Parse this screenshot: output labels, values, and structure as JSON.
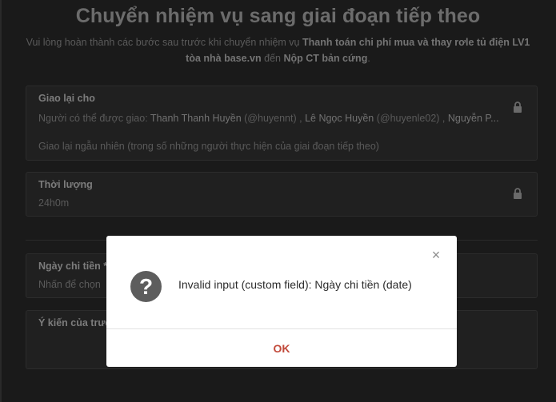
{
  "page": {
    "title": "Chuyển nhiệm vụ sang giai đoạn tiếp theo",
    "subtitle": {
      "prefix": "Vui lòng hoàn thành các bước sau trước khi chuyển nhiệm vụ ",
      "task": "Thanh toán chi phí mua và thay rơle tủ điện LV1 tòa nhà base.vn",
      "middle": " đến ",
      "stage": "Nộp CT bản cứng",
      "suffix": "."
    }
  },
  "reassign": {
    "label": "Giao lại cho",
    "assignees_prefix": "Người có thể được giao: ",
    "assignee1_name": "Thanh Thanh Huyền",
    "assignee1_handle": " (@huyennt)",
    "sep": "  , ",
    "assignee2_name": "Lê Ngọc Huyền",
    "assignee2_handle": " (@huyenle02)",
    "sep2": "  , ",
    "assignee3_name": "Nguyễn P...",
    "random_text": "Giao lại ngẫu nhiên (trong số những người thực hiện của giai đoạn tiếp theo)"
  },
  "duration": {
    "label": "Thời lượng",
    "value": "24h0m"
  },
  "payment_date": {
    "label": "Ngày chi tiền *",
    "placeholder": "Nhấn để chọn"
  },
  "opinion": {
    "label": "Ý kiến của trưở"
  },
  "modal": {
    "message": "Invalid input (custom field): Ngày chi tiền (date)",
    "ok_label": "OK",
    "close_glyph": "×",
    "icon_glyph": "?"
  },
  "icons": {
    "lock": "lock-icon",
    "question": "question-icon",
    "close": "close-icon"
  }
}
